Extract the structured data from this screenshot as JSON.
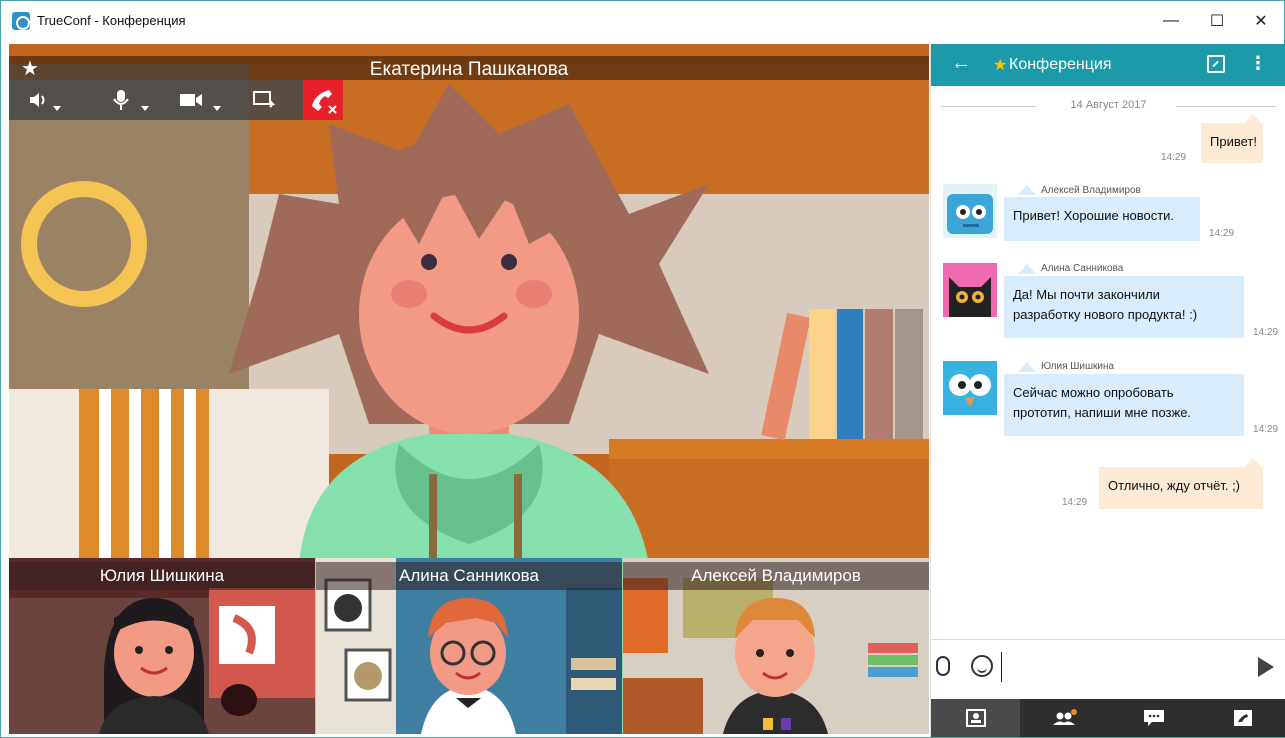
{
  "window": {
    "title": "TrueConf - Конференция",
    "minimize": "—",
    "maximize": "☐",
    "close": "✕"
  },
  "video": {
    "main_caller": "Екатерина Пашканова",
    "star_icon": "★",
    "toolbar": {
      "speaker_icon": "speaker-icon",
      "mic_icon": "microphone-icon",
      "camera_icon": "camera-icon",
      "share_icon": "screen-share-icon",
      "hangup_icon": "hangup-icon"
    },
    "thumbnails": [
      {
        "name": "Юлия Шишкина"
      },
      {
        "name": "Алина Санникова"
      },
      {
        "name": "Алексей Владимиров"
      }
    ]
  },
  "chat": {
    "back": "←",
    "title_star": "★",
    "title": "Конференция",
    "more": "⋮",
    "date": "14 Август 2017",
    "messages": [
      {
        "text": "Привет!",
        "time": "14:29"
      },
      {
        "sender": "Алексей Владимиров",
        "text": "Привет! Хорошие новости.",
        "time": "14:29"
      },
      {
        "sender": "Алина Санникова",
        "line1": "Да! Мы почти закончили",
        "line2": "разработку нового продукта! :)",
        "time": "14:29"
      },
      {
        "sender": "Юлия Шишкина",
        "line1": "Сейчас можно опробовать",
        "line2": "прототип, напиши мне позже.",
        "time": "14:29"
      },
      {
        "text": "Отлично, жду отчёт. ;)",
        "time": "14:29"
      }
    ],
    "input": {
      "value": "",
      "placeholder": ""
    },
    "tabs": [
      "contacts-tab",
      "participants-tab",
      "chat-tab",
      "settings-tab"
    ]
  },
  "colors": {
    "accent": "#1b9aaa",
    "hangup": "#e8202a",
    "my_bubble": "#fdebd6",
    "their_bubble": "#d8ecfb"
  }
}
